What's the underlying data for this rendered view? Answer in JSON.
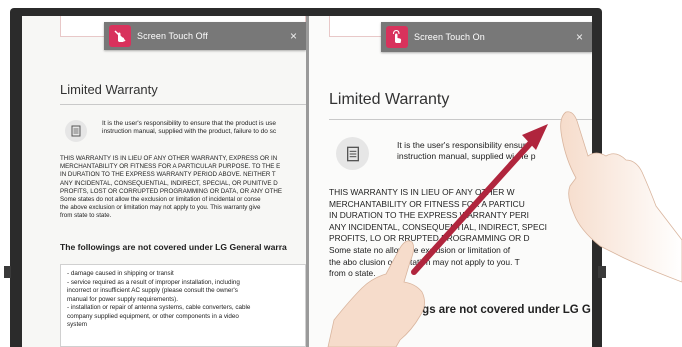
{
  "left_panel": {
    "toast": {
      "icon": "touch-off-icon",
      "label": "Screen Touch Off",
      "close": "×"
    },
    "title": "Limited Warranty",
    "intro_lines": [
      "It is the user's responsibility to ensure that the product is use",
      "instruction manual, supplied with the product, failure to do sc"
    ],
    "body_lines": [
      "THIS WARRANTY IS IN LIEU OF ANY OTHER WARRANTY, EXPRESS OR IN",
      "MERCHANTABILITY OR FITNESS FOR A PARTICULAR PURPOSE. TO THE E",
      "IN DURATION TO THE EXPRESS WARRANTY PERIOD ABOVE. NEITHER T",
      "ANY INCIDENTAL, CONSEQUENTIAL, INDIRECT, SPECIAL, OR PUNITIVE D",
      "PROFITS, LOST OR CORRUPTED PROGRAMMING OR DATA, OR ANY OTHE",
      "Some states do not allow the exclusion or limitation of incidental or conse",
      "the above exclusion or limitation may not apply to you. This warranty give",
      "from state to state."
    ],
    "subheading": "The followings are not covered under LG General warra",
    "bullets": [
      "- damage caused in shipping or transit",
      "- service required as a result of improper installation, including",
      "  incorrect or insufficient AC supply (please consult the owner's",
      "  manual for power supply requirements).",
      "- installation or repair of antenna systems, cable converters, cable",
      "  company supplied equipment, or other components in a video",
      "  system"
    ]
  },
  "right_panel": {
    "toast": {
      "icon": "touch-on-icon",
      "label": "Screen Touch On",
      "close": "×"
    },
    "title": "Limited Warranty",
    "intro_lines": [
      "It is the user's responsibility   ensure",
      "instruction manual, supplied wi    the p"
    ],
    "body_lines": [
      "THIS WARRANTY IS IN LIEU OF ANY OTHER W",
      "MERCHANTABILITY OR FITNESS FOR A PARTICU",
      "IN DURATION TO THE EXPRESS WARRANTY PERI",
      "ANY INCIDENTAL, CONSEQUENTIAL, INDIRECT, SPECI",
      "PROFITS, LO   OR  RRUPTED PROGRAMMING OR D",
      "Some state   no   allow the exclusion or limitation of",
      "the abo    clusion or limitation may not apply to you. T",
      "from    o state."
    ],
    "subheading": "wings are not covered under LG G"
  },
  "colors": {
    "accent": "#d8325c",
    "toast_bg": "#787878",
    "arrow": "#b0253d",
    "bezel": "#2b2b2b"
  }
}
